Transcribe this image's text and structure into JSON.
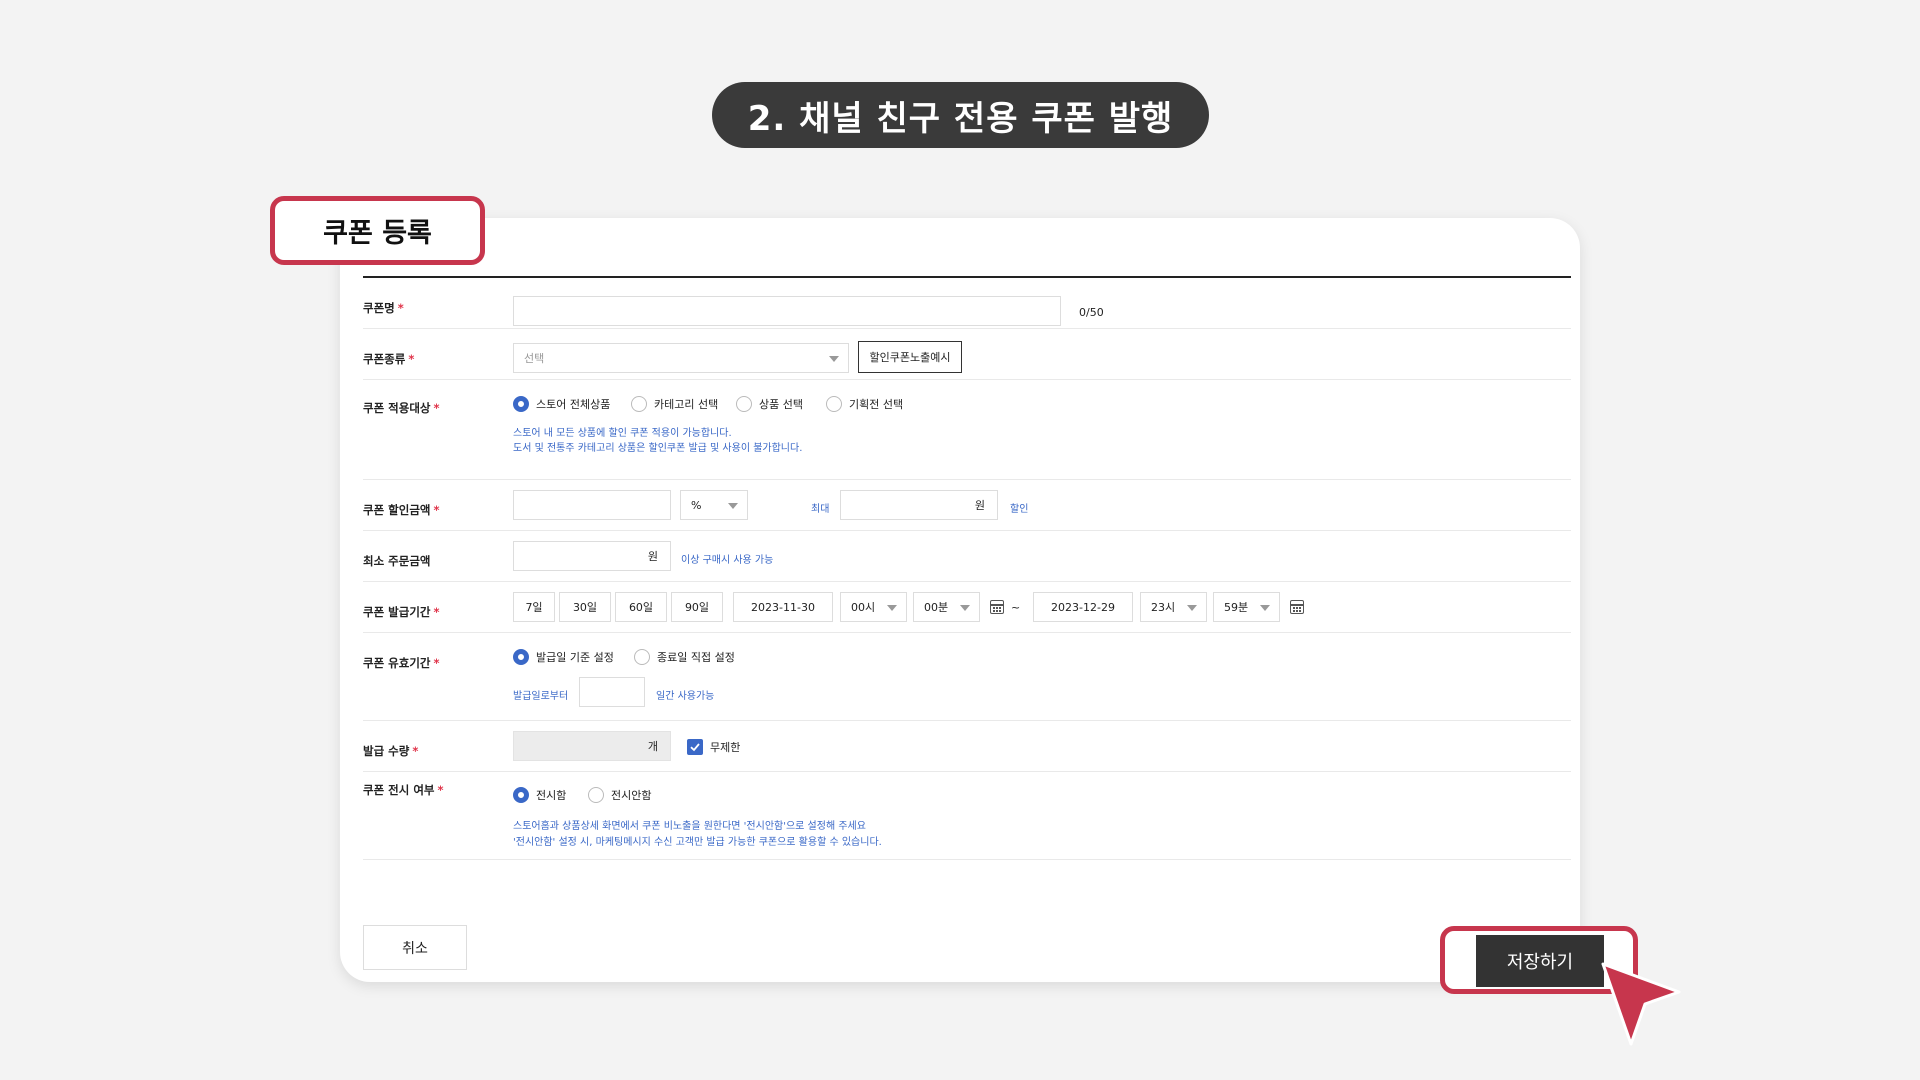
{
  "header_title": "2. 채널 친구 전용 쿠폰 발행",
  "section_tag": "쿠폰 등록",
  "form": {
    "coupon_name": {
      "label": "쿠폰명",
      "required": "*",
      "value": "",
      "counter": "0/50"
    },
    "coupon_type": {
      "label": "쿠폰종류",
      "required": "*",
      "placeholder": "선택",
      "preview_button": "할인쿠폰노출예시"
    },
    "coupon_target": {
      "label": "쿠폰 적용대상",
      "required": "*",
      "options": [
        "스토어 전체상품",
        "카테고리 선택",
        "상품 선택",
        "기획전 선택"
      ],
      "selected": "스토어 전체상품",
      "help1": "스토어 내 모든 상품에 할인 쿠폰 적용이 가능합니다.",
      "help2": "도서 및 전통주 카테고리 상품은 할인쿠폰 발급 및 사용이 불가합니다."
    },
    "discount": {
      "label": "쿠폰 할인금액",
      "required": "*",
      "value": "",
      "unit_select": "%",
      "max_label": "최대",
      "max_unit": "원",
      "suffix": "할인"
    },
    "min_order": {
      "label": "최소 주문금액",
      "unit": "원",
      "suffix": "이상 구매시 사용 가능"
    },
    "issue_period": {
      "label": "쿠폰 발급기간",
      "required": "*",
      "quick": [
        "7일",
        "30일",
        "60일",
        "90일"
      ],
      "start_date": "2023-11-30",
      "start_hour": "00시",
      "start_min": "00분",
      "tilde": "~",
      "end_date": "2023-12-29",
      "end_hour": "23시",
      "end_min": "59분"
    },
    "valid_period": {
      "label": "쿠폰 유효기간",
      "required": "*",
      "options": [
        "발급일 기준 설정",
        "종료일 직접 설정"
      ],
      "selected": "발급일 기준 설정",
      "from_label": "발급일로부터",
      "days_suffix": "일간 사용가능"
    },
    "quantity": {
      "label": "발급 수량",
      "required": "*",
      "unit": "개",
      "unlimited_label": "무제한",
      "unlimited_checked": true
    },
    "display": {
      "label": "쿠폰 전시 여부",
      "required": "*",
      "options": [
        "전시함",
        "전시안함"
      ],
      "selected": "전시함",
      "help1": "스토어홈과 상품상세 화면에서 쿠폰 비노출을 원한다면 '전시안함'으로 설정해 주세요",
      "help2": "'전시안함' 설정 시, 마케팅메시지 수신 고객만 발급 가능한 쿠폰으로 활용할 수 있습니다."
    }
  },
  "buttons": {
    "cancel": "취소",
    "save": "저장하기"
  },
  "colors": {
    "accent_red": "#c7364d",
    "brand_blue": "#3a68c7",
    "dark": "#333333"
  }
}
